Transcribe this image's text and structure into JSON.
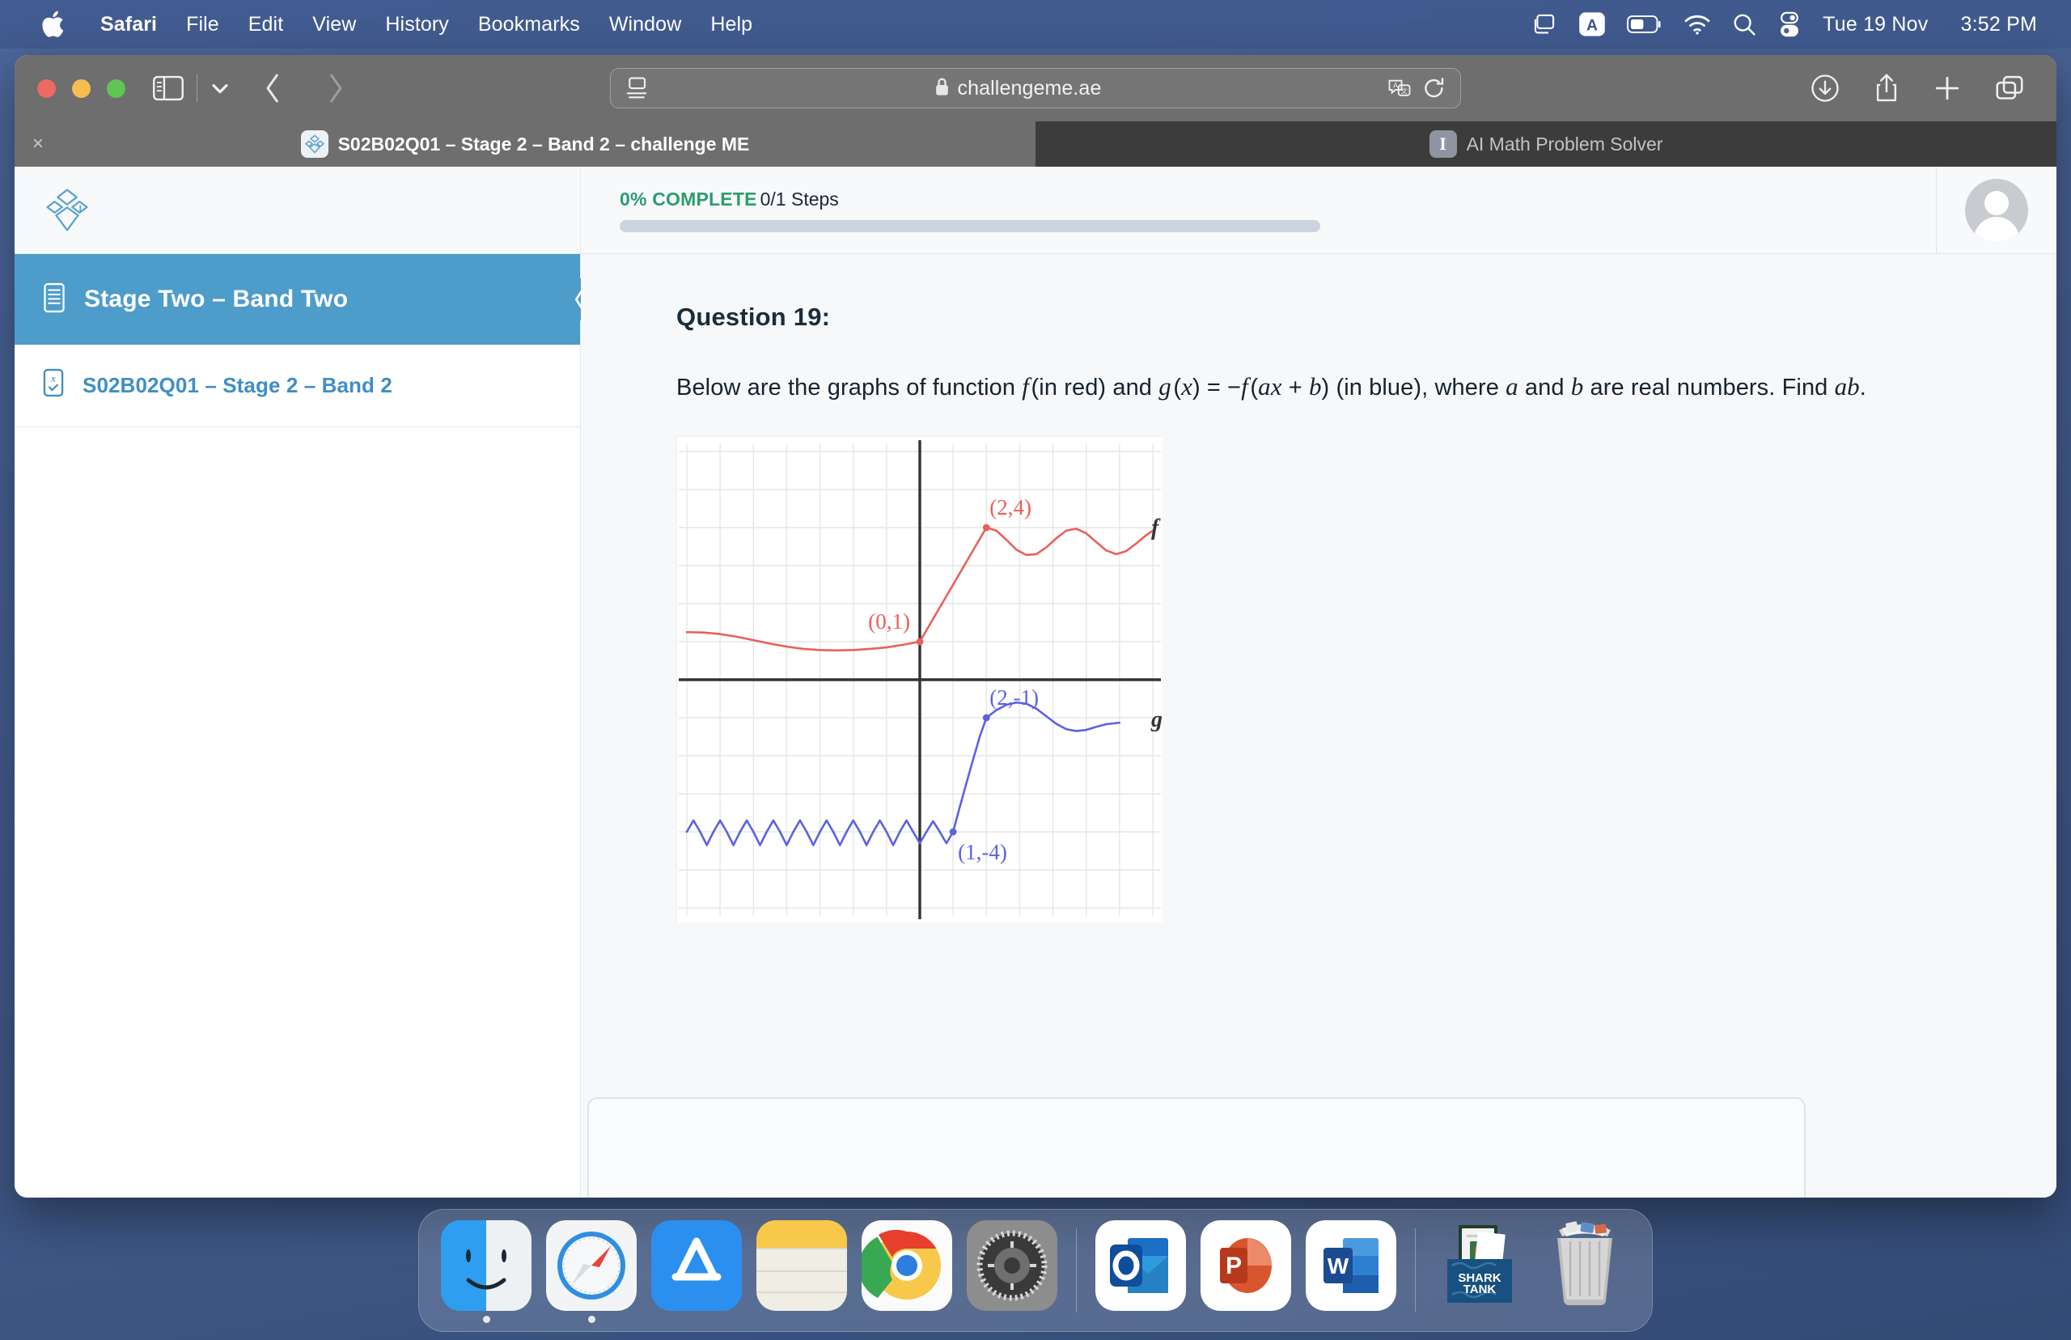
{
  "menubar": {
    "apple_icon": "apple-logo",
    "items": [
      {
        "label": "Safari",
        "bold": true
      },
      {
        "label": "File",
        "bold": false
      },
      {
        "label": "Edit",
        "bold": false
      },
      {
        "label": "View",
        "bold": false
      },
      {
        "label": "History",
        "bold": false
      },
      {
        "label": "Bookmarks",
        "bold": false
      },
      {
        "label": "Window",
        "bold": false
      },
      {
        "label": "Help",
        "bold": false
      }
    ],
    "status_icons": [
      "screen-mirroring-icon",
      "input-source-a-icon",
      "battery-icon",
      "wifi-icon",
      "spotlight-search-icon",
      "control-center-icon"
    ],
    "date": "Tue 19 Nov",
    "time": "3:52 PM"
  },
  "browser": {
    "toolbar": {
      "sidebar_icon": "sidebar-toggle-icon",
      "chevron_icon": "chevron-down-icon",
      "back_icon": "back-arrow-icon",
      "forward_icon": "forward-arrow-icon",
      "reader_icon": "reader-view-icon",
      "lock_icon": "lock-icon",
      "url": "challengeme.ae",
      "translate_icon": "translate-icon",
      "reload_icon": "reload-icon",
      "downloads_icon": "downloads-icon",
      "share_icon": "share-icon",
      "new_tab_icon": "plus-icon",
      "tab_overview_icon": "tab-overview-icon"
    },
    "tabs": [
      {
        "title": "S02B02Q01 – Stage 2 – Band 2 – challenge ME",
        "favicon": "challengeme-logo-icon",
        "active": true,
        "close_icon": "×"
      },
      {
        "title": "AI Math Problem Solver",
        "favicon": "I",
        "active": false
      }
    ]
  },
  "app": {
    "logo_icon": "challengeme-stacked-diamonds-logo",
    "progress": {
      "percent_label": "0% COMPLETE",
      "steps_label": "0/1 Steps",
      "value": 0,
      "accent_color": "#2a9d6e",
      "track_color": "#ccd4e0"
    },
    "account": {
      "avatar_icon": "default-user-avatar"
    },
    "sidebar": {
      "header": {
        "icon": "module-document-icon",
        "label": "Stage Two – Band Two",
        "collapse_icon": "chevron-left-icon",
        "color": "#4e9cc9"
      },
      "items": [
        {
          "icon": "quiz-checklist-icon",
          "label": "S02B02Q01 – Stage 2 – Band 2"
        }
      ]
    },
    "main": {
      "question_title": "Question 19:",
      "question_parts": [
        {
          "type": "text",
          "value": "Below are the graphs of function "
        },
        {
          "type": "italic",
          "value": "f"
        },
        {
          "type": "text",
          "value": " (in red) and "
        },
        {
          "type": "italic",
          "value": "g"
        },
        {
          "type": "text",
          "value": " ("
        },
        {
          "type": "italic",
          "value": "x"
        },
        {
          "type": "text",
          "value": ") = −"
        },
        {
          "type": "italic",
          "value": "f"
        },
        {
          "type": "text",
          "value": " ("
        },
        {
          "type": "italic",
          "value": "ax"
        },
        {
          "type": "text",
          "value": " + "
        },
        {
          "type": "italic",
          "value": "b"
        },
        {
          "type": "text",
          "value": ") (in blue), where "
        },
        {
          "type": "italic",
          "value": "a"
        },
        {
          "type": "text",
          "value": " and "
        },
        {
          "type": "italic",
          "value": "b"
        },
        {
          "type": "text",
          "value": " are real numbers. Find "
        },
        {
          "type": "italic",
          "value": "ab"
        },
        {
          "type": "text",
          "value": "."
        }
      ],
      "question_text_plain": "Below are the graphs of function f (in red) and g (x) = −f (ax + b) (in blue), where a and b are real numbers. Find ab.",
      "answer_input": {
        "value": "",
        "placeholder": ""
      }
    }
  },
  "chart_data": {
    "type": "line",
    "title": "",
    "xlabel": "",
    "ylabel": "",
    "xlim": [
      -7,
      7
    ],
    "ylim": [
      -6,
      6
    ],
    "grid": true,
    "grid_step": 1,
    "axes_color": "#333333",
    "grid_color": "#e6e6e6",
    "legend": "inline-curve-labels",
    "series": [
      {
        "name": "f",
        "label": "f",
        "color": "#e8615a",
        "label_color": "#333333",
        "description": "Damped wave on the left near y=1, linear rise from (0,1) to (2,4), then damped oscillation settling near y=3.6",
        "annotations": [
          {
            "text": "(0,1)",
            "x": 0,
            "y": 1,
            "color": "#e8615a"
          },
          {
            "text": "(2,4)",
            "x": 2,
            "y": 4,
            "color": "#e8615a"
          }
        ],
        "points": [
          {
            "x": 0,
            "y": 1,
            "marked": true
          },
          {
            "x": 2,
            "y": 4,
            "marked": true
          }
        ],
        "polyline": [
          [
            -7.0,
            1.25
          ],
          [
            -6.5,
            1.24
          ],
          [
            -6.0,
            1.2
          ],
          [
            -5.5,
            1.13
          ],
          [
            -5.0,
            1.04
          ],
          [
            -4.5,
            0.95
          ],
          [
            -4.0,
            0.87
          ],
          [
            -3.5,
            0.81
          ],
          [
            -3.0,
            0.78
          ],
          [
            -2.5,
            0.77
          ],
          [
            -2.0,
            0.78
          ],
          [
            -1.5,
            0.81
          ],
          [
            -1.0,
            0.85
          ],
          [
            -0.5,
            0.92
          ],
          [
            0.0,
            1.0
          ],
          [
            0.5,
            1.75
          ],
          [
            1.0,
            2.5
          ],
          [
            1.5,
            3.25
          ],
          [
            2.0,
            4.0
          ],
          [
            2.3,
            3.92
          ],
          [
            2.6,
            3.68
          ],
          [
            2.9,
            3.42
          ],
          [
            3.2,
            3.28
          ],
          [
            3.5,
            3.3
          ],
          [
            3.8,
            3.48
          ],
          [
            4.1,
            3.72
          ],
          [
            4.4,
            3.92
          ],
          [
            4.7,
            3.97
          ],
          [
            5.0,
            3.85
          ],
          [
            5.3,
            3.62
          ],
          [
            5.6,
            3.4
          ],
          [
            5.9,
            3.3
          ],
          [
            6.2,
            3.38
          ],
          [
            6.5,
            3.58
          ],
          [
            6.8,
            3.8
          ],
          [
            7.0,
            3.92
          ]
        ]
      },
      {
        "name": "g",
        "label": "g",
        "color": "#5b62e0",
        "label_color": "#333333",
        "description": "Rapid oscillation about y=-4 on the left, minimum at (1,-4), steep rise to (2,-1), then a smooth bump peaking near y=-0.6 settling near y=-1.2",
        "annotations": [
          {
            "text": "(2,-1)",
            "x": 2,
            "y": -1,
            "color": "#5b62e0"
          },
          {
            "text": "(1,-4)",
            "x": 1,
            "y": -4,
            "color": "#5b62e0"
          }
        ],
        "points": [
          {
            "x": 1,
            "y": -4,
            "marked": true
          },
          {
            "x": 2,
            "y": -1,
            "marked": true
          }
        ],
        "polyline": [
          [
            -7.0,
            -4.0
          ],
          [
            -6.8,
            -3.7
          ],
          [
            -6.6,
            -4.0
          ],
          [
            -6.4,
            -4.35
          ],
          [
            -6.2,
            -4.0
          ],
          [
            -6.0,
            -3.7
          ],
          [
            -5.8,
            -4.0
          ],
          [
            -5.6,
            -4.35
          ],
          [
            -5.4,
            -4.0
          ],
          [
            -5.2,
            -3.7
          ],
          [
            -5.0,
            -4.0
          ],
          [
            -4.8,
            -4.35
          ],
          [
            -4.6,
            -4.0
          ],
          [
            -4.4,
            -3.7
          ],
          [
            -4.2,
            -4.0
          ],
          [
            -4.0,
            -4.35
          ],
          [
            -3.8,
            -4.0
          ],
          [
            -3.6,
            -3.7
          ],
          [
            -3.4,
            -4.0
          ],
          [
            -3.2,
            -4.35
          ],
          [
            -3.0,
            -4.0
          ],
          [
            -2.8,
            -3.7
          ],
          [
            -2.6,
            -4.0
          ],
          [
            -2.4,
            -4.35
          ],
          [
            -2.2,
            -4.0
          ],
          [
            -2.0,
            -3.7
          ],
          [
            -1.8,
            -4.0
          ],
          [
            -1.6,
            -4.35
          ],
          [
            -1.4,
            -4.0
          ],
          [
            -1.2,
            -3.7
          ],
          [
            -1.0,
            -4.0
          ],
          [
            -0.8,
            -4.35
          ],
          [
            -0.6,
            -4.0
          ],
          [
            -0.4,
            -3.7
          ],
          [
            -0.2,
            -4.0
          ],
          [
            0.0,
            -4.3
          ],
          [
            0.2,
            -4.0
          ],
          [
            0.4,
            -3.72
          ],
          [
            0.6,
            -4.0
          ],
          [
            0.8,
            -4.3
          ],
          [
            1.0,
            -4.0
          ],
          [
            1.2,
            -3.35
          ],
          [
            1.4,
            -2.72
          ],
          [
            1.6,
            -2.1
          ],
          [
            1.8,
            -1.5
          ],
          [
            2.0,
            -1.0
          ],
          [
            2.3,
            -0.8
          ],
          [
            2.6,
            -0.66
          ],
          [
            2.9,
            -0.6
          ],
          [
            3.2,
            -0.63
          ],
          [
            3.5,
            -0.76
          ],
          [
            3.8,
            -0.96
          ],
          [
            4.1,
            -1.16
          ],
          [
            4.4,
            -1.3
          ],
          [
            4.7,
            -1.35
          ],
          [
            5.0,
            -1.32
          ],
          [
            5.3,
            -1.24
          ],
          [
            5.6,
            -1.17
          ],
          [
            6.0,
            -1.13
          ]
        ]
      }
    ]
  },
  "dock": {
    "items": [
      {
        "name": "finder",
        "running": true
      },
      {
        "name": "safari",
        "running": true
      },
      {
        "name": "app-store",
        "running": false
      },
      {
        "name": "notes",
        "running": false
      },
      {
        "name": "chrome",
        "running": false
      },
      {
        "name": "system-settings",
        "running": false
      },
      {
        "name": "separator",
        "running": false
      },
      {
        "name": "outlook",
        "running": false
      },
      {
        "name": "powerpoint",
        "running": false
      },
      {
        "name": "word",
        "running": false
      },
      {
        "name": "separator",
        "running": false
      },
      {
        "name": "shark-tank-stack",
        "label": "SHARK TANK",
        "running": false
      },
      {
        "name": "trash",
        "running": false
      }
    ]
  }
}
